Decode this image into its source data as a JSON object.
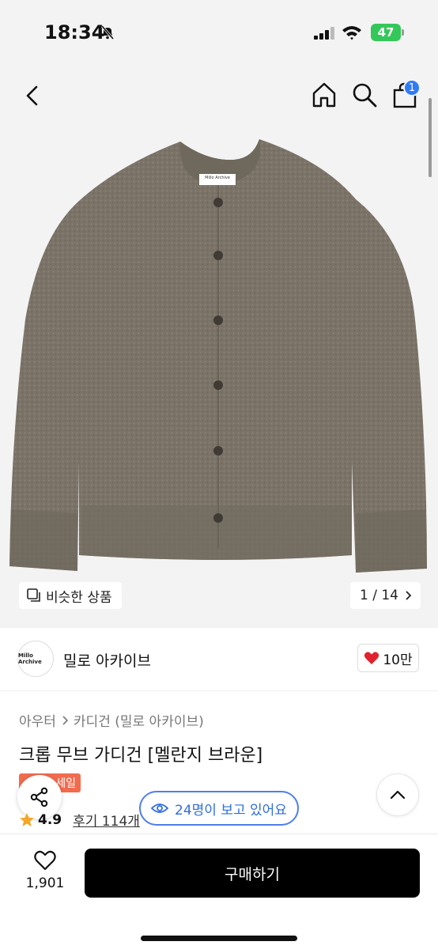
{
  "status_bar": {
    "time": "18:34",
    "battery": "47"
  },
  "nav": {
    "icons": [
      "back-chevron-icon",
      "home-icon",
      "search-icon",
      "shopping-bag-icon"
    ],
    "cart_count": "1"
  },
  "gallery": {
    "garment_label": "Millo Archive",
    "similar_label": "비슷한 상품",
    "counter": "1 / 14"
  },
  "brand": {
    "logo_text": "Millo Archive",
    "name": "밀로 아카이브",
    "likes": "10만"
  },
  "product": {
    "breadcrumb": [
      "아우터",
      "카디건 (밀로 아카이브)"
    ],
    "title": "크롭 무브 가디건 [멜란지 브라운]",
    "badge": "세일",
    "rating": "4.9",
    "reviews": "후기 114개",
    "viewers": "24명이 보고 있어요"
  },
  "bottom_bar": {
    "wish_count": "1,901",
    "buy_label": "구매하기"
  },
  "colors": {
    "primary_blue": "#2f6de1",
    "sale_orange": "#f26b4f",
    "heart_red": "#e0232e",
    "star_yellow": "#f5a623",
    "buy_black": "#000000",
    "sweater_taupe": "#7b7368"
  }
}
